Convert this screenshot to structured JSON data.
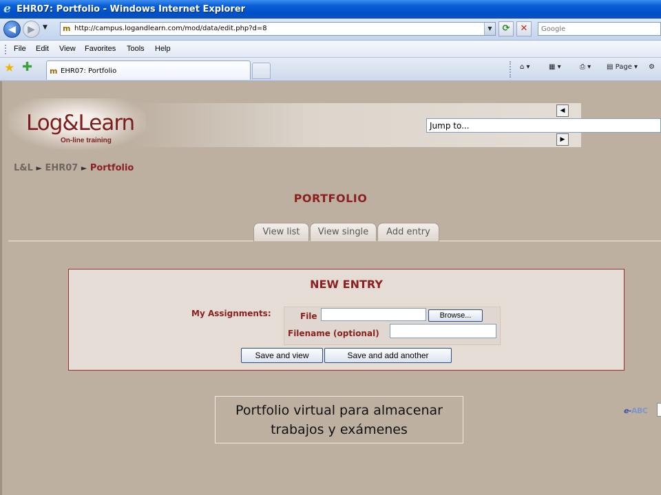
{
  "window": {
    "title": "EHR07: Portfolio - Windows Internet Explorer"
  },
  "addressbar": {
    "url": "http://campus.logandlearn.com/mod/data/edit.php?d=8",
    "search_placeholder": "Google"
  },
  "menu": [
    "File",
    "Edit",
    "View",
    "Favorites",
    "Tools",
    "Help"
  ],
  "tabs": {
    "active_label": "EHR07: Portfolio"
  },
  "commandbar": {
    "page_label": "Page"
  },
  "logo": {
    "wordmark": "Log&Learn",
    "tagline": "On-line training"
  },
  "jump": {
    "label": "Jump to..."
  },
  "breadcrumb": {
    "root": "L&L",
    "course": "EHR07",
    "current": "Portfolio",
    "separator": "►"
  },
  "page_title": "PORTFOLIO",
  "page_tabs": [
    "View list",
    "View single",
    "Add entry"
  ],
  "form": {
    "title": "NEW ENTRY",
    "assignments_label": "My Assignments:",
    "file_label": "File",
    "browse_label": "Browse...",
    "filename_label": "Filename (optional)",
    "save_view": "Save and view",
    "save_add": "Save and add another"
  },
  "caption": {
    "line1": "Portfolio virtual para almacenar",
    "line2": "trabajos y exámenes"
  },
  "corner_logo": {
    "e": "e-",
    "abc": "ABC"
  },
  "colors": {
    "accent": "#8a2020",
    "page_bg": "#bdb0a1",
    "form_bg": "#e5ddd5"
  }
}
